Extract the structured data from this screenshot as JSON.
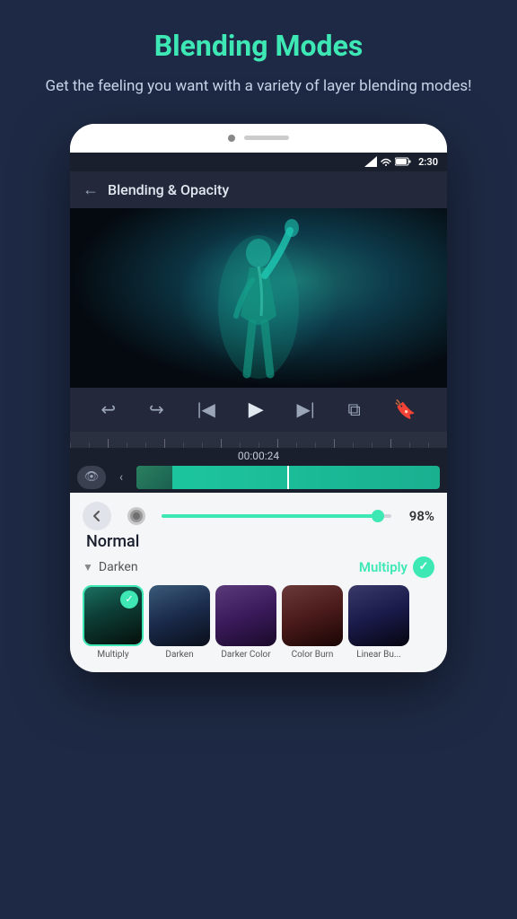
{
  "header": {
    "title": "Blending Modes",
    "subtitle": "Get the feeling you want with a variety of layer blending modes!"
  },
  "statusBar": {
    "time": "2:30"
  },
  "screen": {
    "title": "Blending & Opacity",
    "timeCode": "00:00:24",
    "opacityValue": "98%",
    "currentBlendMode": "Normal",
    "sectionLabel": "Darken",
    "activeBlendMode": "Multiply",
    "blendModes": [
      {
        "label": "Multiply",
        "active": true
      },
      {
        "label": "Darken",
        "active": false
      },
      {
        "label": "Darker Color",
        "active": false
      },
      {
        "label": "Color Burn",
        "active": false
      },
      {
        "label": "Linear Bu...",
        "active": false
      }
    ]
  },
  "controls": {
    "backLabel": "←",
    "skipStartLabel": "|←",
    "playLabel": "▶",
    "skipEndLabel": "→|",
    "loopLabel": "⊙",
    "bookmarkLabel": "⊡"
  }
}
